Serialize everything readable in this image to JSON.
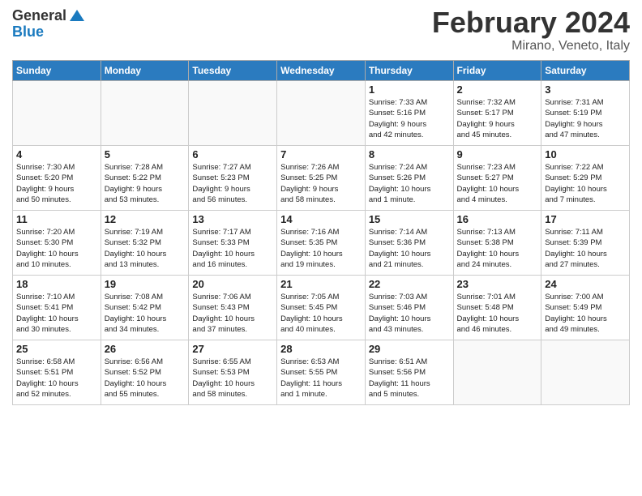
{
  "header": {
    "logo_general": "General",
    "logo_blue": "Blue",
    "month_title": "February 2024",
    "location": "Mirano, Veneto, Italy"
  },
  "days_of_week": [
    "Sunday",
    "Monday",
    "Tuesday",
    "Wednesday",
    "Thursday",
    "Friday",
    "Saturday"
  ],
  "weeks": [
    [
      {
        "num": "",
        "info": ""
      },
      {
        "num": "",
        "info": ""
      },
      {
        "num": "",
        "info": ""
      },
      {
        "num": "",
        "info": ""
      },
      {
        "num": "1",
        "info": "Sunrise: 7:33 AM\nSunset: 5:16 PM\nDaylight: 9 hours\nand 42 minutes."
      },
      {
        "num": "2",
        "info": "Sunrise: 7:32 AM\nSunset: 5:17 PM\nDaylight: 9 hours\nand 45 minutes."
      },
      {
        "num": "3",
        "info": "Sunrise: 7:31 AM\nSunset: 5:19 PM\nDaylight: 9 hours\nand 47 minutes."
      }
    ],
    [
      {
        "num": "4",
        "info": "Sunrise: 7:30 AM\nSunset: 5:20 PM\nDaylight: 9 hours\nand 50 minutes."
      },
      {
        "num": "5",
        "info": "Sunrise: 7:28 AM\nSunset: 5:22 PM\nDaylight: 9 hours\nand 53 minutes."
      },
      {
        "num": "6",
        "info": "Sunrise: 7:27 AM\nSunset: 5:23 PM\nDaylight: 9 hours\nand 56 minutes."
      },
      {
        "num": "7",
        "info": "Sunrise: 7:26 AM\nSunset: 5:25 PM\nDaylight: 9 hours\nand 58 minutes."
      },
      {
        "num": "8",
        "info": "Sunrise: 7:24 AM\nSunset: 5:26 PM\nDaylight: 10 hours\nand 1 minute."
      },
      {
        "num": "9",
        "info": "Sunrise: 7:23 AM\nSunset: 5:27 PM\nDaylight: 10 hours\nand 4 minutes."
      },
      {
        "num": "10",
        "info": "Sunrise: 7:22 AM\nSunset: 5:29 PM\nDaylight: 10 hours\nand 7 minutes."
      }
    ],
    [
      {
        "num": "11",
        "info": "Sunrise: 7:20 AM\nSunset: 5:30 PM\nDaylight: 10 hours\nand 10 minutes."
      },
      {
        "num": "12",
        "info": "Sunrise: 7:19 AM\nSunset: 5:32 PM\nDaylight: 10 hours\nand 13 minutes."
      },
      {
        "num": "13",
        "info": "Sunrise: 7:17 AM\nSunset: 5:33 PM\nDaylight: 10 hours\nand 16 minutes."
      },
      {
        "num": "14",
        "info": "Sunrise: 7:16 AM\nSunset: 5:35 PM\nDaylight: 10 hours\nand 19 minutes."
      },
      {
        "num": "15",
        "info": "Sunrise: 7:14 AM\nSunset: 5:36 PM\nDaylight: 10 hours\nand 21 minutes."
      },
      {
        "num": "16",
        "info": "Sunrise: 7:13 AM\nSunset: 5:38 PM\nDaylight: 10 hours\nand 24 minutes."
      },
      {
        "num": "17",
        "info": "Sunrise: 7:11 AM\nSunset: 5:39 PM\nDaylight: 10 hours\nand 27 minutes."
      }
    ],
    [
      {
        "num": "18",
        "info": "Sunrise: 7:10 AM\nSunset: 5:41 PM\nDaylight: 10 hours\nand 30 minutes."
      },
      {
        "num": "19",
        "info": "Sunrise: 7:08 AM\nSunset: 5:42 PM\nDaylight: 10 hours\nand 34 minutes."
      },
      {
        "num": "20",
        "info": "Sunrise: 7:06 AM\nSunset: 5:43 PM\nDaylight: 10 hours\nand 37 minutes."
      },
      {
        "num": "21",
        "info": "Sunrise: 7:05 AM\nSunset: 5:45 PM\nDaylight: 10 hours\nand 40 minutes."
      },
      {
        "num": "22",
        "info": "Sunrise: 7:03 AM\nSunset: 5:46 PM\nDaylight: 10 hours\nand 43 minutes."
      },
      {
        "num": "23",
        "info": "Sunrise: 7:01 AM\nSunset: 5:48 PM\nDaylight: 10 hours\nand 46 minutes."
      },
      {
        "num": "24",
        "info": "Sunrise: 7:00 AM\nSunset: 5:49 PM\nDaylight: 10 hours\nand 49 minutes."
      }
    ],
    [
      {
        "num": "25",
        "info": "Sunrise: 6:58 AM\nSunset: 5:51 PM\nDaylight: 10 hours\nand 52 minutes."
      },
      {
        "num": "26",
        "info": "Sunrise: 6:56 AM\nSunset: 5:52 PM\nDaylight: 10 hours\nand 55 minutes."
      },
      {
        "num": "27",
        "info": "Sunrise: 6:55 AM\nSunset: 5:53 PM\nDaylight: 10 hours\nand 58 minutes."
      },
      {
        "num": "28",
        "info": "Sunrise: 6:53 AM\nSunset: 5:55 PM\nDaylight: 11 hours\nand 1 minute."
      },
      {
        "num": "29",
        "info": "Sunrise: 6:51 AM\nSunset: 5:56 PM\nDaylight: 11 hours\nand 5 minutes."
      },
      {
        "num": "",
        "info": ""
      },
      {
        "num": "",
        "info": ""
      }
    ]
  ]
}
